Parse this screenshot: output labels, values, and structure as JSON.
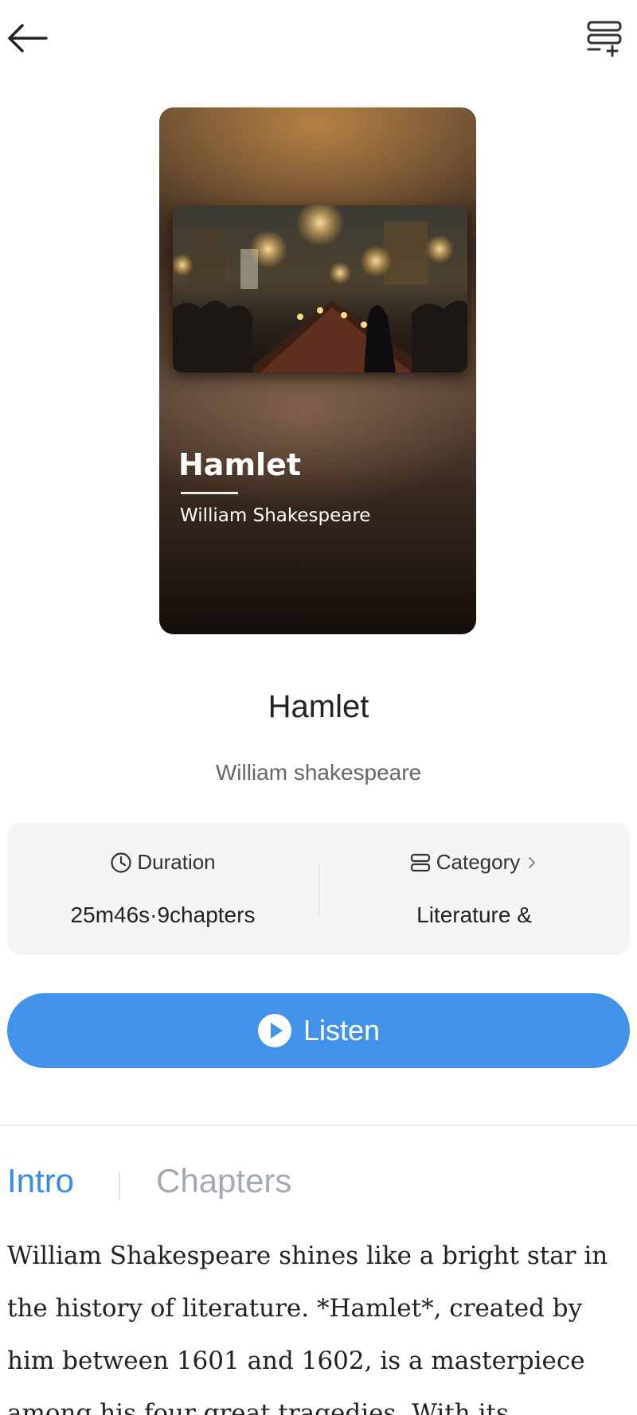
{
  "header": {
    "back_icon": "arrow-left-icon",
    "add_to_list_icon": "list-add-icon"
  },
  "cover": {
    "title": "Hamlet",
    "author": "William Shakespeare",
    "art_description_icon": "banquet-hall-illustration"
  },
  "book": {
    "title": "Hamlet",
    "author": "William shakespeare"
  },
  "info": {
    "duration_label": "Duration",
    "duration_value": "25m46s·9chapters",
    "category_label": "Category",
    "category_value": "Literature &"
  },
  "actions": {
    "listen_label": "Listen"
  },
  "tabs": {
    "intro": "Intro",
    "chapters": "Chapters"
  },
  "intro_text": "William Shakespeare shines like a bright star in the history of literature. *Hamlet*, created by him between 1601 and 1602, is a masterpiece among his four great tragedies. With its",
  "colors": {
    "accent": "#4392ea",
    "tab_active": "#3b8be3",
    "tab_inactive": "#a3a9b3"
  }
}
